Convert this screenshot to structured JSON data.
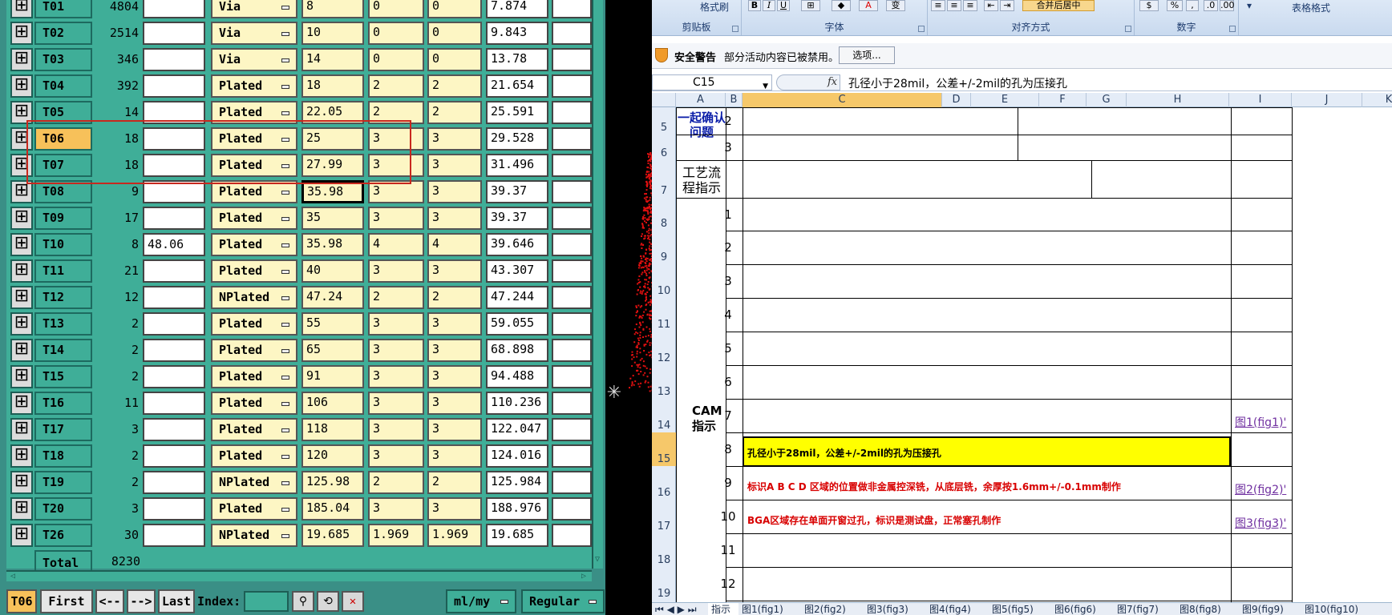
{
  "cam": {
    "rows": [
      {
        "tool": "T01",
        "count": "4804",
        "in1": "",
        "type": "Via",
        "size": "8",
        "p1": "0",
        "p2": "0",
        "res": "7.874"
      },
      {
        "tool": "T02",
        "count": "2514",
        "in1": "",
        "type": "Via",
        "size": "10",
        "p1": "0",
        "p2": "0",
        "res": "9.843"
      },
      {
        "tool": "T03",
        "count": "346",
        "in1": "",
        "type": "Via",
        "size": "14",
        "p1": "0",
        "p2": "0",
        "res": "13.78"
      },
      {
        "tool": "T04",
        "count": "392",
        "in1": "",
        "type": "Plated",
        "size": "18",
        "p1": "2",
        "p2": "2",
        "res": "21.654"
      },
      {
        "tool": "T05",
        "count": "14",
        "in1": "",
        "type": "Plated",
        "size": "22.05",
        "p1": "2",
        "p2": "2",
        "res": "25.591"
      },
      {
        "tool": "T06",
        "count": "18",
        "in1": "",
        "type": "Plated",
        "size": "25",
        "p1": "3",
        "p2": "3",
        "res": "29.528"
      },
      {
        "tool": "T07",
        "count": "18",
        "in1": "",
        "type": "Plated",
        "size": "27.99",
        "p1": "3",
        "p2": "3",
        "res": "31.496"
      },
      {
        "tool": "T08",
        "count": "9",
        "in1": "",
        "type": "Plated",
        "size": "35.98",
        "p1": "3",
        "p2": "3",
        "res": "39.37"
      },
      {
        "tool": "T09",
        "count": "17",
        "in1": "",
        "type": "Plated",
        "size": "35",
        "p1": "3",
        "p2": "3",
        "res": "39.37"
      },
      {
        "tool": "T10",
        "count": "8",
        "in1": "48.06",
        "type": "Plated",
        "size": "35.98",
        "p1": "4",
        "p2": "4",
        "res": "39.646"
      },
      {
        "tool": "T11",
        "count": "21",
        "in1": "",
        "type": "Plated",
        "size": "40",
        "p1": "3",
        "p2": "3",
        "res": "43.307"
      },
      {
        "tool": "T12",
        "count": "12",
        "in1": "",
        "type": "NPlated",
        "size": "47.24",
        "p1": "2",
        "p2": "2",
        "res": "47.244"
      },
      {
        "tool": "T13",
        "count": "2",
        "in1": "",
        "type": "Plated",
        "size": "55",
        "p1": "3",
        "p2": "3",
        "res": "59.055"
      },
      {
        "tool": "T14",
        "count": "2",
        "in1": "",
        "type": "Plated",
        "size": "65",
        "p1": "3",
        "p2": "3",
        "res": "68.898"
      },
      {
        "tool": "T15",
        "count": "2",
        "in1": "",
        "type": "Plated",
        "size": "91",
        "p1": "3",
        "p2": "3",
        "res": "94.488"
      },
      {
        "tool": "T16",
        "count": "11",
        "in1": "",
        "type": "Plated",
        "size": "106",
        "p1": "3",
        "p2": "3",
        "res": "110.236"
      },
      {
        "tool": "T17",
        "count": "3",
        "in1": "",
        "type": "Plated",
        "size": "118",
        "p1": "3",
        "p2": "3",
        "res": "122.047"
      },
      {
        "tool": "T18",
        "count": "2",
        "in1": "",
        "type": "Plated",
        "size": "120",
        "p1": "3",
        "p2": "3",
        "res": "124.016"
      },
      {
        "tool": "T19",
        "count": "2",
        "in1": "",
        "type": "NPlated",
        "size": "125.98",
        "p1": "2",
        "p2": "2",
        "res": "125.984"
      },
      {
        "tool": "T20",
        "count": "3",
        "in1": "",
        "type": "Plated",
        "size": "185.04",
        "p1": "3",
        "p2": "3",
        "res": "188.976"
      },
      {
        "tool": "T26",
        "count": "30",
        "in1": "",
        "type": "NPlated",
        "size": "19.685",
        "p1": "1.969",
        "p2": "1.969",
        "res": "19.685"
      }
    ],
    "total_label": "Total",
    "total_value": "8230",
    "selected_tool": "T06",
    "bar": {
      "current": "T06",
      "first": "First",
      "prev": "<--",
      "next": "-->",
      "last": "Last",
      "index_label": "Index:",
      "unit": "ml/my",
      "mode": "Regular"
    }
  },
  "excel": {
    "ribbon": {
      "groups": [
        "剪贴板",
        "字体",
        "对齐方式",
        "数字"
      ],
      "format_painter": "格式刷",
      "merge_center": "合并后居中",
      "percent": "%",
      "table_format": "表格格式"
    },
    "security": {
      "title": "安全警告",
      "message": "部分活动内容已被禁用。",
      "button": "选项..."
    },
    "name_box": "C15",
    "fx": "fx",
    "formula": "孔径小于28mil，公差+/-2mil的孔为压接孔",
    "columns": [
      "A",
      "B",
      "C",
      "D",
      "E",
      "F",
      "G",
      "H",
      "I",
      "J",
      "K"
    ],
    "rows": [
      "5",
      "6",
      "7",
      "8",
      "9",
      "10",
      "11",
      "12",
      "13",
      "14",
      "15",
      "16",
      "17",
      "18",
      "19"
    ],
    "cells": {
      "a5": "一起确认问题",
      "a7": "工艺流程指示",
      "a_cam": "CAM指示",
      "cut_off": "C指",
      "b_nums_top": [
        "2",
        "3"
      ],
      "b_nums": [
        "1",
        "2",
        "3",
        "4",
        "5",
        "6",
        "7",
        "8",
        "9",
        "10",
        "11",
        "12"
      ],
      "c15": "孔径小于28mil，公差+/-2mil的孔为压接孔",
      "c16": "标识A B C D 区域的位置做非金属控深铣，从底层铣，余厚按1.6mm+/-0.1mm制作",
      "c17": "BGA区域存在单面开窗过孔，标识是测试盘，正常塞孔制作",
      "j14": "图1(fig1)'",
      "j16": "图2(fig2)'",
      "j17": "图3(fig3)'"
    },
    "sheet_tabs": [
      "指示",
      "图1(fig1)",
      "图2(fig2)",
      "图3(fig3)",
      "图4(fig4)",
      "图5(fig5)",
      "图6(fig6)",
      "图7(fig7)",
      "图8(fig8)",
      "图9(fig9)",
      "图10(fig10)"
    ]
  },
  "colors": {
    "cam_bg": "#3fae98",
    "cam_cell": "#fdf6c4",
    "cam_selected": "#f7c15a",
    "highlight_yellow": "#ffff00",
    "note_red": "#d80000",
    "link_purple": "#7030a0"
  }
}
